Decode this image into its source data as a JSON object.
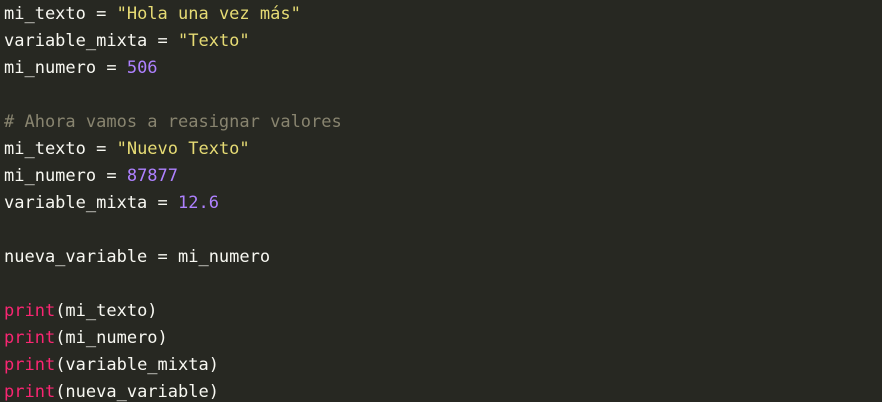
{
  "editor": {
    "theme": {
      "background": "#272822",
      "text": "#F8F8F2",
      "string": "#E6DB74",
      "number": "#AE81FF",
      "comment": "#88846F",
      "builtin": "#F92672"
    },
    "lines": [
      [
        {
          "t": "mi_texto = ",
          "k": "plain"
        },
        {
          "t": "\"Hola una vez más\"",
          "k": "str"
        }
      ],
      [
        {
          "t": "variable_mixta = ",
          "k": "plain"
        },
        {
          "t": "\"Texto\"",
          "k": "str"
        }
      ],
      [
        {
          "t": "mi_numero = ",
          "k": "plain"
        },
        {
          "t": "506",
          "k": "num"
        }
      ],
      [],
      [
        {
          "t": "# Ahora vamos a reasignar valores",
          "k": "comment"
        }
      ],
      [
        {
          "t": "mi_texto = ",
          "k": "plain"
        },
        {
          "t": "\"Nuevo Texto\"",
          "k": "str"
        }
      ],
      [
        {
          "t": "mi_numero = ",
          "k": "plain"
        },
        {
          "t": "87877",
          "k": "num"
        }
      ],
      [
        {
          "t": "variable_mixta = ",
          "k": "plain"
        },
        {
          "t": "12.6",
          "k": "num"
        }
      ],
      [],
      [
        {
          "t": "nueva_variable = mi_numero",
          "k": "plain"
        }
      ],
      [],
      [
        {
          "t": "print",
          "k": "fn"
        },
        {
          "t": "(mi_texto)",
          "k": "plain"
        }
      ],
      [
        {
          "t": "print",
          "k": "fn"
        },
        {
          "t": "(mi_numero)",
          "k": "plain"
        }
      ],
      [
        {
          "t": "print",
          "k": "fn"
        },
        {
          "t": "(variable_mixta)",
          "k": "plain"
        }
      ],
      [
        {
          "t": "print",
          "k": "fn"
        },
        {
          "t": "(nueva_variable)",
          "k": "plain"
        }
      ]
    ]
  }
}
